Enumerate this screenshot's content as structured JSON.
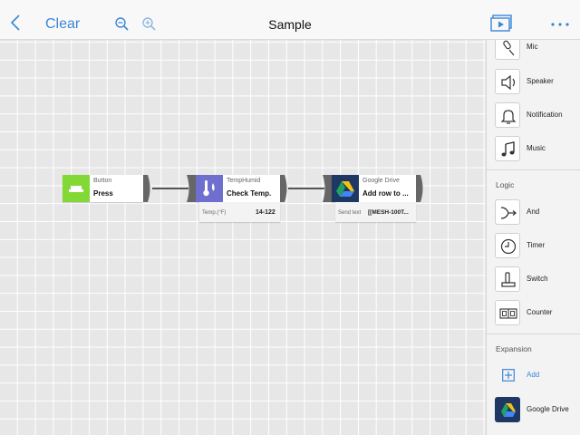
{
  "toolbar": {
    "clear_label": "Clear",
    "title": "Sample",
    "icons": [
      "chevron-left-icon",
      "zoom-out-icon",
      "zoom-in-icon",
      "presentation-icon",
      "more-icon"
    ]
  },
  "canvas": {
    "blocks": [
      {
        "id": "button",
        "type_label": "Button",
        "action_label": "Press",
        "color": "#82d935",
        "icon": "button-icon"
      },
      {
        "id": "temphumid",
        "type_label": "TempHumid",
        "action_label": "Check Temp.",
        "color": "#6f6fcf",
        "icon": "thermometer-icon",
        "param_label": "Temp.(°F)",
        "param_value": "14-122"
      },
      {
        "id": "gdrive",
        "type_label": "Google Drive",
        "action_label": "Add row to ...",
        "color": "#1f3763",
        "icon": "google-drive-icon",
        "param_label": "Send text",
        "param_value": "[[MESH-100T..."
      }
    ]
  },
  "panel": {
    "items": [
      {
        "label": "Mic",
        "icon": "mic-icon"
      },
      {
        "label": "Speaker",
        "icon": "speaker-icon"
      },
      {
        "label": "Notification",
        "icon": "bell-icon"
      },
      {
        "label": "Music",
        "icon": "music-icon"
      }
    ],
    "logic_title": "Logic",
    "logic_items": [
      {
        "label": "And",
        "icon": "and-icon"
      },
      {
        "label": "Timer",
        "icon": "clock-icon"
      },
      {
        "label": "Switch",
        "icon": "switch-icon"
      },
      {
        "label": "Counter",
        "icon": "counter-icon"
      }
    ],
    "expansion_title": "Expansion",
    "expansion_items": [
      {
        "label": "Add",
        "icon": "add-icon"
      },
      {
        "label": "Google Drive",
        "icon": "google-drive-icon"
      }
    ]
  },
  "colors": {
    "accent": "#3b86d8",
    "button_green": "#82d935",
    "temphumid_purple": "#6f6fcf",
    "drive_navy": "#1f3763"
  }
}
